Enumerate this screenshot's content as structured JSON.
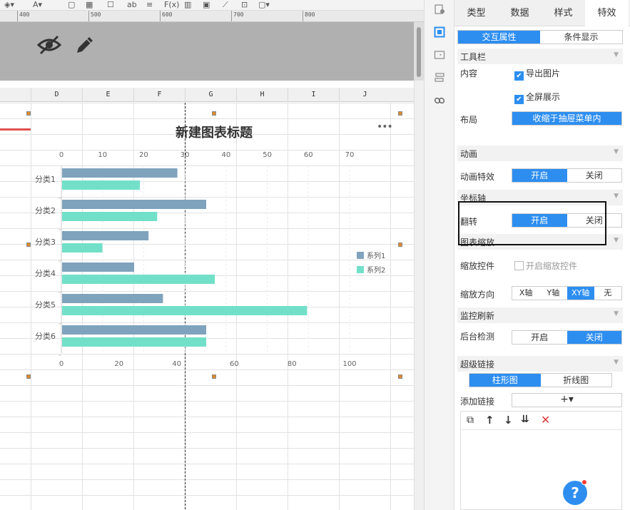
{
  "ruler": {
    "ticks": [
      "400",
      "500",
      "600",
      "700",
      "800"
    ]
  },
  "sheet": {
    "columns": [
      "D",
      "E",
      "F",
      "G",
      "H",
      "I",
      "J"
    ]
  },
  "chart_data": {
    "type": "bar",
    "title": "新建图表标题",
    "categories": [
      "分类1",
      "分类2",
      "分类3",
      "分类4",
      "分类5",
      "分类6"
    ],
    "top_axis": {
      "ticks": [
        "0",
        "10",
        "20",
        "30",
        "40",
        "50",
        "60",
        "70"
      ],
      "range": [
        0,
        70
      ]
    },
    "bottom_axis": {
      "ticks": [
        "0",
        "20",
        "40",
        "60",
        "80",
        "100"
      ],
      "range": [
        0,
        100
      ]
    },
    "series": [
      {
        "name": "系列1",
        "color": "#7fa3bd",
        "values": [
          40,
          50,
          30,
          25,
          35,
          50
        ]
      },
      {
        "name": "系列2",
        "color": "#72e0c8",
        "values": [
          27,
          33,
          14,
          53,
          85,
          50
        ]
      }
    ],
    "legend": "right",
    "more_icon": "ellipsis"
  },
  "panel": {
    "tabs": [
      "类型",
      "数据",
      "样式",
      "特效"
    ],
    "active_tab": "特效",
    "sub_tabs": [
      "交互属性",
      "条件显示"
    ],
    "toolbar_section": "工具栏",
    "content_label": "内容",
    "export_image": "导出图片",
    "fullscreen": "全屏展示",
    "layout_label": "布局",
    "layout_value": "收缩于抽屉菜单内",
    "animation_section": "动画",
    "animation_effect_label": "动画特效",
    "on": "开启",
    "off": "关闭",
    "axis_section": "坐标轴",
    "flip_label": "翻转",
    "zoom_section": "图表缩放",
    "zoom_control_label": "缩放控件",
    "enable_zoom": "开启缩放控件",
    "zoom_direction_label": "缩放方向",
    "zoom_directions": [
      "X轴",
      "Y轴",
      "XY轴",
      "无"
    ],
    "monitor_section": "监控刷新",
    "backend_check_label": "后台检测",
    "hyperlink_section": "超级链接",
    "link_tabs": [
      "柱形图",
      "折线图"
    ],
    "add_link_label": "添加链接",
    "add_symbol": "+▾",
    "help": "?"
  }
}
